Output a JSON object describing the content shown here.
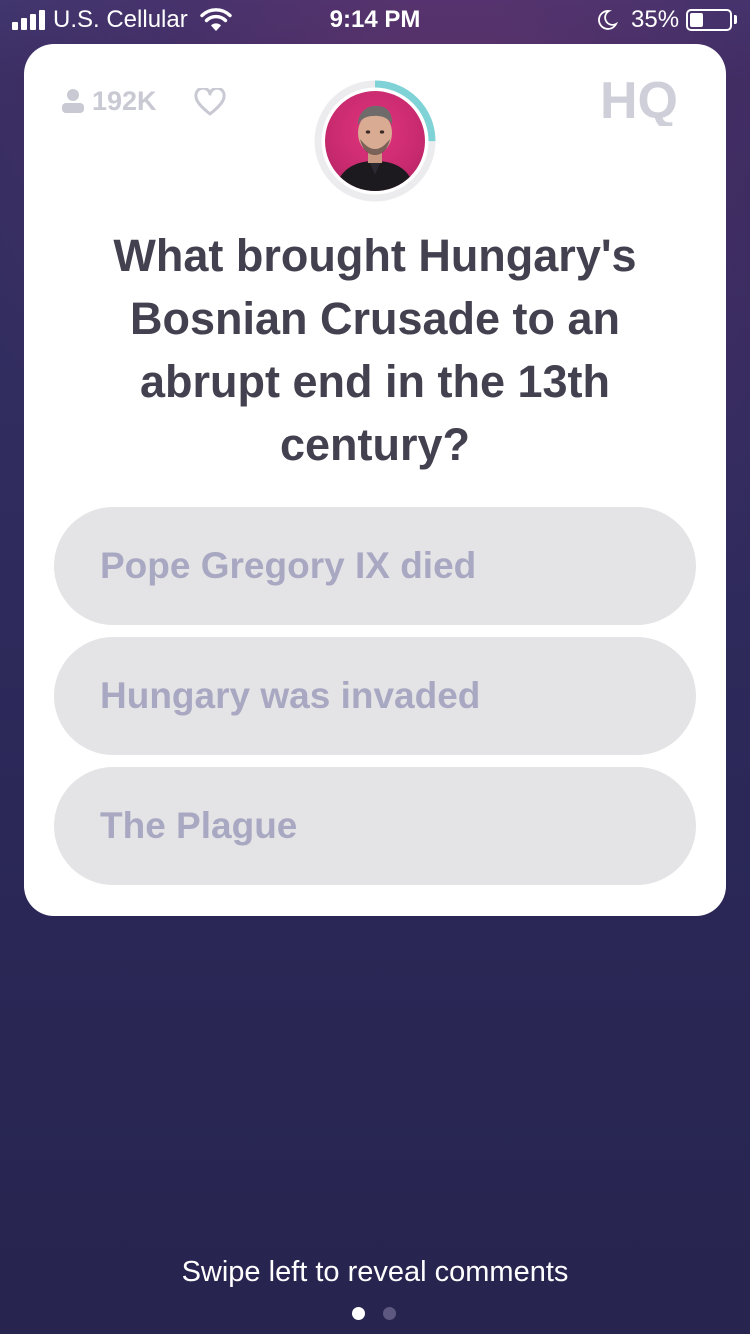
{
  "status_bar": {
    "carrier": "U.S. Cellular",
    "time": "9:14 PM",
    "battery_percent": "35%",
    "battery_level": 0.35,
    "icons": [
      "signal-icon",
      "wifi-icon",
      "moon-icon",
      "battery-icon"
    ]
  },
  "game": {
    "viewer_count": "192K",
    "logo": "HQ",
    "host_timer_remaining": 0.25,
    "question": "What brought Hungary's Bosnian Crusade to an abrupt end in the 13th century?",
    "answers": [
      "Pope Gregory IX died",
      "Hungary was invaded",
      "The Plague"
    ]
  },
  "footer": {
    "hint": "Swipe left to reveal comments",
    "page_dots": {
      "count": 2,
      "active": 1
    }
  },
  "colors": {
    "card": "#ffffff",
    "answer_bg": "#e4e4e6",
    "answer_text": "#a9a8c2",
    "question_text": "#43414f",
    "timer_ring": "#7fd3d6",
    "avatar_bg": "#d42d74",
    "background": "#2b2858"
  }
}
